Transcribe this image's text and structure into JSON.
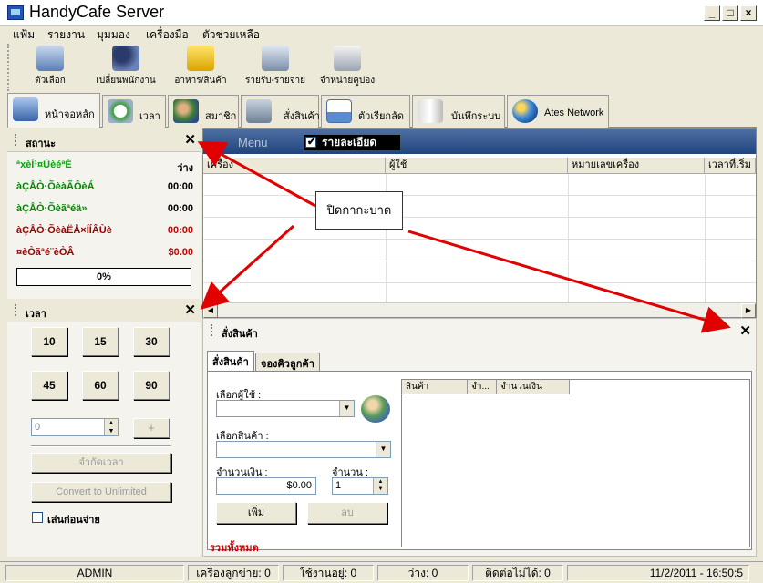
{
  "window": {
    "title": "HandyCafe Server"
  },
  "menubar": [
    "แฟ้ม",
    "รายงาน",
    "มุมมอง",
    "เครื่องมือ",
    "ตัวช่วยเหลือ"
  ],
  "toolbar": {
    "items": [
      {
        "label": "ตัวเลือก",
        "icon": "computer-options-icon"
      },
      {
        "label": "เปลี่ยนพนักงาน",
        "icon": "change-staff-icon"
      },
      {
        "label": "อาหาร/สินค้า",
        "icon": "food-products-icon"
      },
      {
        "label": "รายรับ-รายจ่าย",
        "icon": "cash-register-icon"
      },
      {
        "label": "จำหน่ายคูปอง",
        "icon": "printer-coupon-icon"
      }
    ]
  },
  "tabs": [
    {
      "label": "หน้าจอหลัก",
      "icon": "main-screen-icon"
    },
    {
      "label": "เวลา",
      "icon": "stopwatch-icon"
    },
    {
      "label": "สมาชิก",
      "icon": "members-icon"
    },
    {
      "label": "สั่งสินค้า",
      "icon": "shopping-cart-icon"
    },
    {
      "label": "ตัวเรียกลัด",
      "icon": "shortcuts-icon"
    },
    {
      "label": "บันทึกระบบ",
      "icon": "system-log-icon"
    },
    {
      "label": "Ates Network",
      "icon": "globe-icon"
    }
  ],
  "status_panel": {
    "title": "สถานะ",
    "rows": [
      {
        "label": "ªxèÍ¹¤ÙèéªÉ",
        "value": "ว่าง"
      },
      {
        "label": "àÇÅÒ·ÕèàÃÔèÁ",
        "value": "00:00"
      },
      {
        "label": "àÇÅÒ·Õèãªéä»",
        "value": "00:00"
      },
      {
        "label": "àÇÅÒ·ÕèàËÅ×ÍÍÂÙè",
        "value": "00:00"
      },
      {
        "label": "¤èÒãªé¨èÒÂ",
        "value": "$0.00"
      }
    ],
    "progress": "0%"
  },
  "time_panel": {
    "title": "เวลา",
    "buttons": [
      "10",
      "15",
      "30",
      "45",
      "60",
      "90"
    ],
    "spinner_value": "0",
    "plus": "+",
    "limit_button": "จำกัดเวลา",
    "unlimited_button": "Convert to Unlimited",
    "prepay_label": "เล่นก่อนจ่าย"
  },
  "grid": {
    "menu_label": "Menu",
    "detail_label": "รายละเอียด",
    "columns": [
      "เครื่อง",
      "ผู้ใช้",
      "หมายเลขเครื่อง",
      "เวลาที่เริ่ม"
    ]
  },
  "order_panel": {
    "title": "สั่งสินค้า",
    "tabs": [
      "สั่งสินค้า",
      "จองคิวลูกค้า"
    ],
    "select_user_label": "เลือกผู้ใช้ :",
    "select_product_label": "เลือกสินค้า :",
    "amount_label": "จำนวนเงิน :",
    "amount_value": "$0.00",
    "qty_label": "จำนวน :",
    "qty_value": "1",
    "add_button": "เพิ่ม",
    "delete_button": "ลบ",
    "total_label": "รวมทั้งหมด",
    "list_columns": [
      "สินค้า",
      "จำ...",
      "จำนวนเงิน"
    ]
  },
  "callout": {
    "text": "ปิดกากะบาด"
  },
  "statusbar": {
    "user": "ADMIN",
    "cells": [
      "เครื่องลูกข่าย: 0",
      "ใช้งานอยู่: 0",
      "ว่าง: 0",
      "ติดต่อไม่ได้: 0"
    ],
    "datetime": "11/2/2011 - 16:50:5"
  },
  "colors": {
    "accent_red": "#cc0000",
    "status_green": "#00aa00",
    "header_blue": "#20447e"
  }
}
